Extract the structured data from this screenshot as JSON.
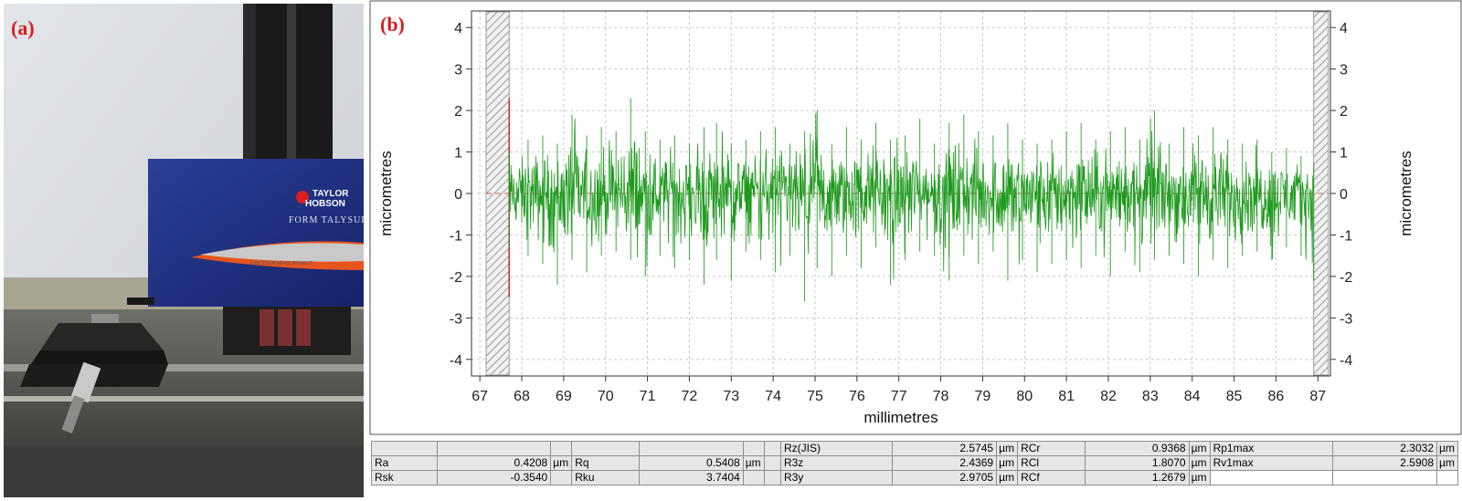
{
  "photo": {
    "label": "(a)",
    "brand_line1": "TAYLOR",
    "brand_line2": "HOBSON",
    "product": "FORM TALYSURF",
    "caption": "PRECISION MEASUREMENT"
  },
  "chart": {
    "label": "(b)"
  },
  "chart_data": {
    "type": "line",
    "title": "",
    "xlabel": "millimetres",
    "ylabel": "micrometres",
    "ylabel_right": "micrometres",
    "xlim": [
      66.8,
      87.3
    ],
    "ylim": [
      -4.4,
      4.4
    ],
    "xticks": [
      67,
      68,
      69,
      70,
      71,
      72,
      73,
      74,
      75,
      76,
      77,
      78,
      79,
      80,
      81,
      82,
      83,
      84,
      85,
      86,
      87
    ],
    "yticks": [
      4,
      3,
      2,
      1,
      0,
      -1,
      -2,
      -3,
      -4
    ],
    "grid": true,
    "profile_start": 67.7,
    "profile_end": 86.9,
    "excluded_regions": [
      [
        67.15,
        67.7
      ],
      [
        86.9,
        87.25
      ]
    ],
    "zero_line": 0,
    "series_color": "#1e9a1e",
    "series": [
      {
        "x": [
          67.7,
          68.15,
          68.5,
          68.85,
          69.2,
          69.55,
          69.9,
          70.25,
          70.6,
          70.95,
          71.3,
          71.65,
          72.0,
          72.35,
          72.65,
          73.0,
          73.35,
          73.7,
          74.05,
          74.4,
          74.75,
          75.05,
          75.4,
          75.75,
          76.1,
          76.45,
          76.8,
          77.15,
          77.5,
          77.85,
          78.2,
          78.55,
          78.9,
          79.25,
          79.6,
          79.95,
          80.3,
          80.65,
          81.0,
          81.35,
          81.7,
          82.05,
          82.4,
          82.75,
          83.1,
          83.45,
          83.8,
          84.15,
          84.5,
          84.85,
          85.2,
          85.55,
          85.9,
          86.25,
          86.6,
          86.9
        ],
        "y_max": [
          1.0,
          1.3,
          1.4,
          1.2,
          1.9,
          1.4,
          1.6,
          1.5,
          2.3,
          1.5,
          1.3,
          1.4,
          1.2,
          1.6,
          1.7,
          1.2,
          1.3,
          1.5,
          1.6,
          1.2,
          1.5,
          2.0,
          1.2,
          1.6,
          1.3,
          1.7,
          1.3,
          1.4,
          1.8,
          1.2,
          1.7,
          1.9,
          1.5,
          1.4,
          1.7,
          1.3,
          1.2,
          1.3,
          1.5,
          1.7,
          1.3,
          1.5,
          1.6,
          1.3,
          2.0,
          1.2,
          1.6,
          1.4,
          1.6,
          1.3,
          1.2,
          1.3,
          1.0,
          1.1,
          0.9,
          0.7
        ],
        "y_min": [
          -1.3,
          -1.5,
          -1.7,
          -2.2,
          -1.6,
          -1.9,
          -1.5,
          -1.4,
          -1.6,
          -2.0,
          -1.5,
          -1.8,
          -1.6,
          -2.2,
          -1.6,
          -2.1,
          -1.4,
          -1.6,
          -1.9,
          -1.5,
          -2.6,
          -1.8,
          -2.0,
          -1.5,
          -1.8,
          -1.3,
          -2.2,
          -1.6,
          -1.4,
          -1.5,
          -2.1,
          -1.5,
          -1.7,
          -1.4,
          -2.1,
          -1.6,
          -1.9,
          -1.7,
          -1.6,
          -1.8,
          -1.5,
          -2.0,
          -1.4,
          -1.9,
          -1.6,
          -1.5,
          -1.7,
          -2.0,
          -1.6,
          -1.8,
          -1.5,
          -1.4,
          -1.6,
          -1.3,
          -1.5,
          -2.1
        ]
      }
    ]
  },
  "stats": {
    "rows": [
      [
        "",
        "",
        "",
        "",
        "",
        "",
        "",
        "Rz(JIS)",
        "2.5745",
        "µm",
        "RCr",
        "0.9368",
        "µm",
        "Rp1max",
        "2.3032",
        "µm"
      ],
      [
        "Ra",
        "0.4208",
        "µm",
        "Rq",
        "0.5408",
        "µm",
        "",
        "R3z",
        "2.4369",
        "µm",
        "RCl",
        "1.8070",
        "µm",
        "Rv1max",
        "2.5908",
        "µm"
      ],
      [
        "Rsk",
        "-0.3540",
        "",
        "Rku",
        "3.7404",
        "",
        "",
        "R3y",
        "2.9705",
        "µm",
        "RCf",
        "1.2679",
        "µm",
        "",
        "",
        ""
      ]
    ]
  }
}
